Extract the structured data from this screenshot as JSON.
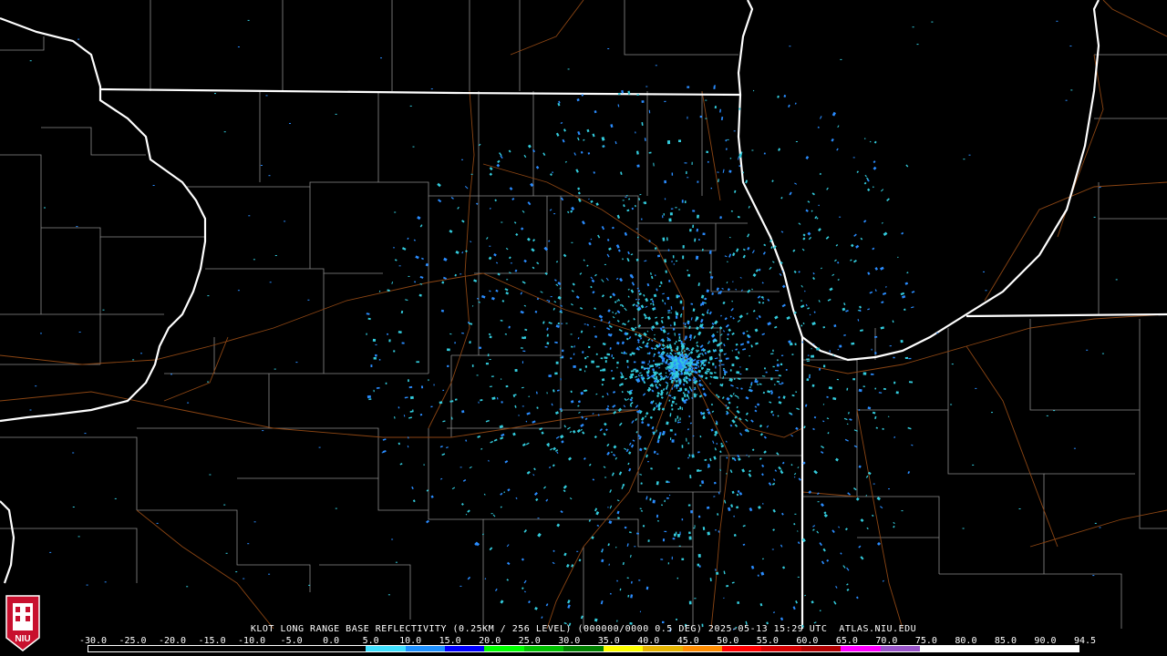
{
  "product": {
    "station": "KLOT",
    "caption": "KLOT LONG RANGE BASE REFLECTIVITY (0.25KM / 256 LEVEL) (000000/0000 0.5 DEG) 2025-05-13 15:29 UTC  ATLAS.NIU.EDU",
    "valid_time": "2025-05-13 15:29 UTC",
    "source": "ATLAS.NIU.EDU",
    "elevation": "0.5 DEG"
  },
  "scale": {
    "labels": [
      "-30.0",
      "-25.0",
      "-20.0",
      "-15.0",
      "-10.0",
      "-5.0",
      "0.0",
      "5.0",
      "10.0",
      "15.0",
      "20.0",
      "25.0",
      "30.0",
      "35.0",
      "40.0",
      "45.0",
      "50.0",
      "55.0",
      "60.0",
      "65.0",
      "70.0",
      "75.0",
      "80.0",
      "85.0",
      "90.0",
      "94.5"
    ],
    "colors": [
      "#000000",
      "#000000",
      "#000000",
      "#000000",
      "#000000",
      "#000000",
      "#000000",
      "#40e0ff",
      "#1e90ff",
      "#0000ff",
      "#00ff00",
      "#00c000",
      "#008000",
      "#ffff00",
      "#e6b400",
      "#ff8c00",
      "#ff0000",
      "#d40000",
      "#b00000",
      "#ff00ff",
      "#9955c9",
      "#ffffff",
      "#ffffff",
      "#ffffff",
      "#ffffff"
    ]
  },
  "logo": {
    "text": "NIU",
    "color": "#c8102e"
  },
  "map_colors": {
    "state_border": "#ffffff",
    "county": "#8c8c8c",
    "highway": "#8b4513",
    "echo_light": "#33ccdd",
    "echo_mid": "#2a8cff"
  }
}
